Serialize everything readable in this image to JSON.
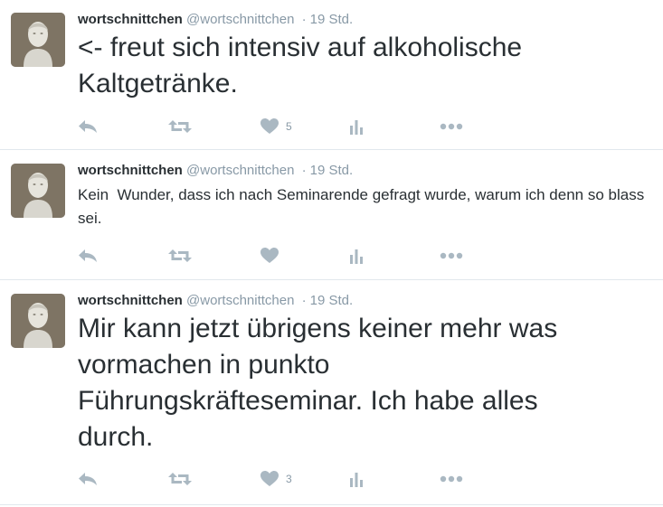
{
  "tweets": [
    {
      "name": "wortschnittchen",
      "handle": "@wortschnittchen",
      "separator": "·",
      "time": "19 Std.",
      "text": "<- freut sich intensiv auf alkoholische Kaltgetränke.",
      "like_count": "5"
    },
    {
      "name": "wortschnittchen",
      "handle": "@wortschnittchen",
      "separator": "·",
      "time": "19 Std.",
      "text": "Kein  Wunder, dass ich nach Seminarende gefragt wurde, warum ich denn so blass sei.",
      "like_count": ""
    },
    {
      "name": "wortschnittchen",
      "handle": "@wortschnittchen",
      "separator": "·",
      "time": "19 Std.",
      "text": "Mir kann jetzt übrigens keiner mehr was vormachen in punkto Führungskräfteseminar. Ich habe alles durch.",
      "like_count": "3"
    }
  ],
  "icons": {
    "reply": "reply-icon",
    "retweet": "retweet-icon",
    "like": "heart-icon",
    "analytics": "analytics-icon",
    "more": "more-icon"
  },
  "colors": {
    "text": "#292f33",
    "muted": "#8899a6",
    "icon": "#aab8c2",
    "divider": "#e1e8ed"
  }
}
